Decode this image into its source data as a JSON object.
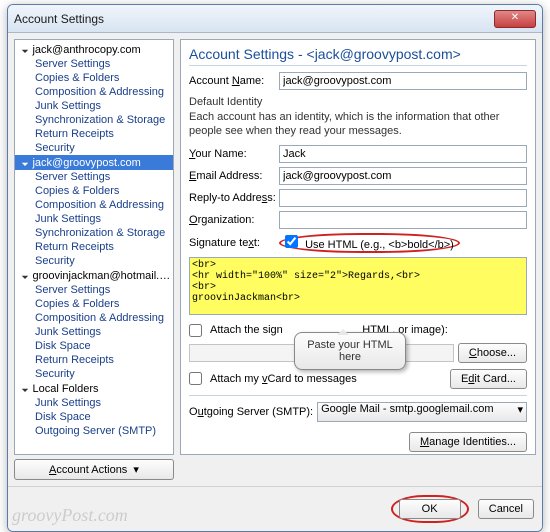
{
  "window": {
    "title": "Account Settings"
  },
  "tree": {
    "accounts": [
      {
        "name": "jack@anthrocopy.com",
        "items": [
          "Server Settings",
          "Copies & Folders",
          "Composition & Addressing",
          "Junk Settings",
          "Synchronization & Storage",
          "Return Receipts",
          "Security"
        ]
      },
      {
        "name": "jack@groovypost.com",
        "selected": true,
        "items": [
          "Server Settings",
          "Copies & Folders",
          "Composition & Addressing",
          "Junk Settings",
          "Synchronization & Storage",
          "Return Receipts",
          "Security"
        ]
      },
      {
        "name": "groovinjackman@hotmail.c...",
        "items": [
          "Server Settings",
          "Copies & Folders",
          "Composition & Addressing",
          "Junk Settings",
          "Disk Space",
          "Return Receipts",
          "Security"
        ]
      },
      {
        "name": "Local Folders",
        "items": [
          "Junk Settings",
          "Disk Space",
          "Outgoing Server (SMTP)"
        ]
      }
    ],
    "actions_label": "Account Actions"
  },
  "panel": {
    "heading_prefix": "Account Settings - ",
    "heading_email": "<jack@groovypost.com>",
    "account_name_label": "Account Name:",
    "account_name": "jack@groovypost.com",
    "identity_label": "Default Identity",
    "identity_desc": "Each account has an identity, which is the information that other people see when they read your messages.",
    "your_name_label": "Your Name:",
    "your_name": "Jack",
    "email_label": "Email Address:",
    "email": "jack@groovypost.com",
    "reply_label": "Reply-to Address:",
    "reply": "",
    "org_label": "Organization:",
    "org": "",
    "sig_label": "Signature text:",
    "use_html_label": "Use HTML (e.g., <b>bold</b>)",
    "use_html_checked": true,
    "sig_text": "<br>\n<hr width=\"100%\" size=\"2\">Regards,<br>\n<br>\ngroovinJackman<br>",
    "attach_sig_prefix": "Attach the sign",
    "attach_sig_suffix": "HTML, or image):",
    "choose_label": "Choose...",
    "attach_vcard_label": "Attach my vCard to messages",
    "edit_card_label": "Edit Card...",
    "smtp_label": "Outgoing Server (SMTP):",
    "smtp_value": "Google Mail - smtp.googlemail.com",
    "manage_label": "Manage Identities..."
  },
  "footer": {
    "ok": "OK",
    "cancel": "Cancel"
  },
  "callout": "Paste your HTML here",
  "watermark": "groovyPost.com"
}
